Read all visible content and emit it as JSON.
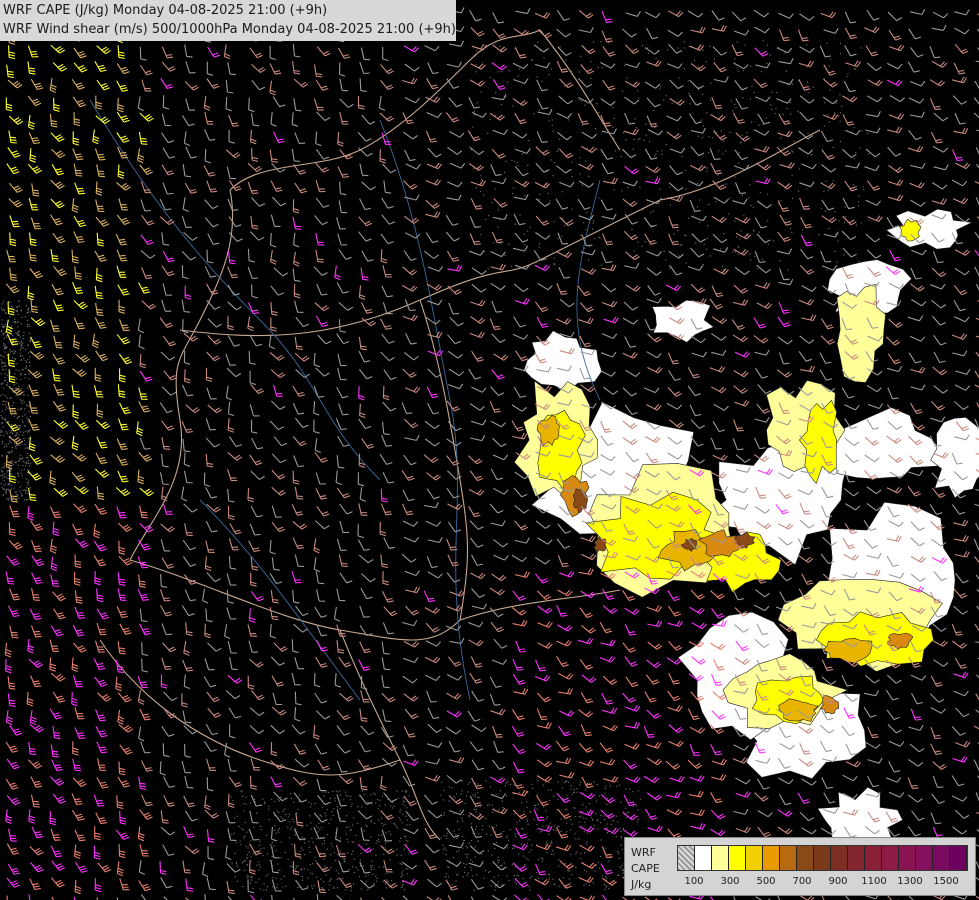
{
  "header": {
    "line1": "WRF CAPE (J/kg) Monday 04-08-2025 21:00 (+9h)",
    "line2": "WRF Wind shear (m/s) 500/1000hPa Monday 04-08-2025 21:00 (+9h)"
  },
  "legend": {
    "model": "WRF",
    "variable": "CAPE",
    "unit": "J/kg",
    "colors": [
      "hatch",
      "#ffffff",
      "#ffff99",
      "#ffff00",
      "#f2d000",
      "#e89a00",
      "#b86a10",
      "#8a4a18",
      "#7a3a1a",
      "#7d2f25",
      "#83262f",
      "#892038",
      "#8c1c45",
      "#8a1452",
      "#85105d",
      "#7a0a60",
      "#6e0060"
    ],
    "tick_labels": [
      "100",
      "300",
      "500",
      "700",
      "900",
      "1100",
      "1300",
      "1500"
    ]
  },
  "map_data": {
    "type": "weather-map",
    "background": "#000000",
    "cape_blobs_colors": {
      "white": "#ffffff",
      "light_yellow": "#ffff99",
      "yellow": "#ffff00",
      "gold": "#e8b400",
      "orange": "#d88a10",
      "brown": "#8a4a18"
    },
    "wind_barb_colors": {
      "weak": "#9a9a9a",
      "moderate": "#c98a80",
      "strong": "#e88070",
      "very_strong": "#ff33ff",
      "west_strong": "#ffff33",
      "west_mid": "#d8b060"
    },
    "border_color": "#c8a890",
    "river_color": "#3a6a9a"
  }
}
